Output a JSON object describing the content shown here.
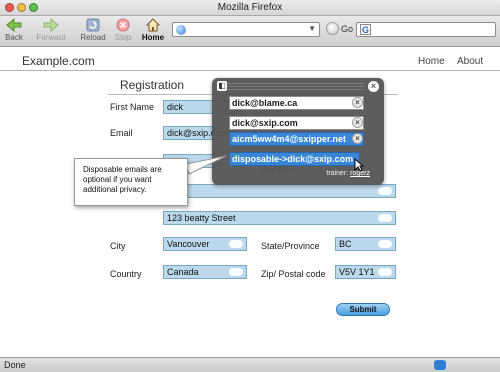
{
  "window": {
    "title": "Mozilla Firefox"
  },
  "toolbar": {
    "back_label": "Back",
    "forward_label": "Forward",
    "reload_label": "Reload",
    "stop_label": "Stop",
    "home_label": "Home",
    "go_label": "Go"
  },
  "page": {
    "site_name": "Example.com",
    "nav": {
      "home": "Home",
      "about": "About"
    },
    "title": "Registration"
  },
  "form": {
    "first_name_label": "First Name",
    "first_name_value": "dick",
    "email_label": "Email",
    "email_value": "dick@sxip.com",
    "confirm_label_partial": "confirm",
    "address_partial": "23",
    "address2_value": "123 beatty Street",
    "city_label": "City",
    "city_value": "Vancouver",
    "state_label": "State/Province",
    "state_value": "BC",
    "country_label": "Country",
    "country_value": "Canada",
    "postal_label": "Zip/ Postal code",
    "postal_value": "V5V 1Y1",
    "submit_label": "Submit"
  },
  "popup": {
    "items": [
      {
        "value": "dick@blame.ca"
      },
      {
        "value": "dick@sxip.com"
      },
      {
        "value": "aicm5ww4m4@sxipper.net"
      },
      {
        "value": "disposable->dick@sxip.com"
      }
    ],
    "trainer_label": "trainer:",
    "trainer_link": "rogerz"
  },
  "tooltip": {
    "text": "Disposable emails are optional if you want additional privacy."
  },
  "status": {
    "text": "Done"
  },
  "colors": {
    "field_bg": "#bcd9ec",
    "popup_bg": "#555555",
    "selected": "#2e80d6",
    "submit": "#4a9fe0"
  }
}
